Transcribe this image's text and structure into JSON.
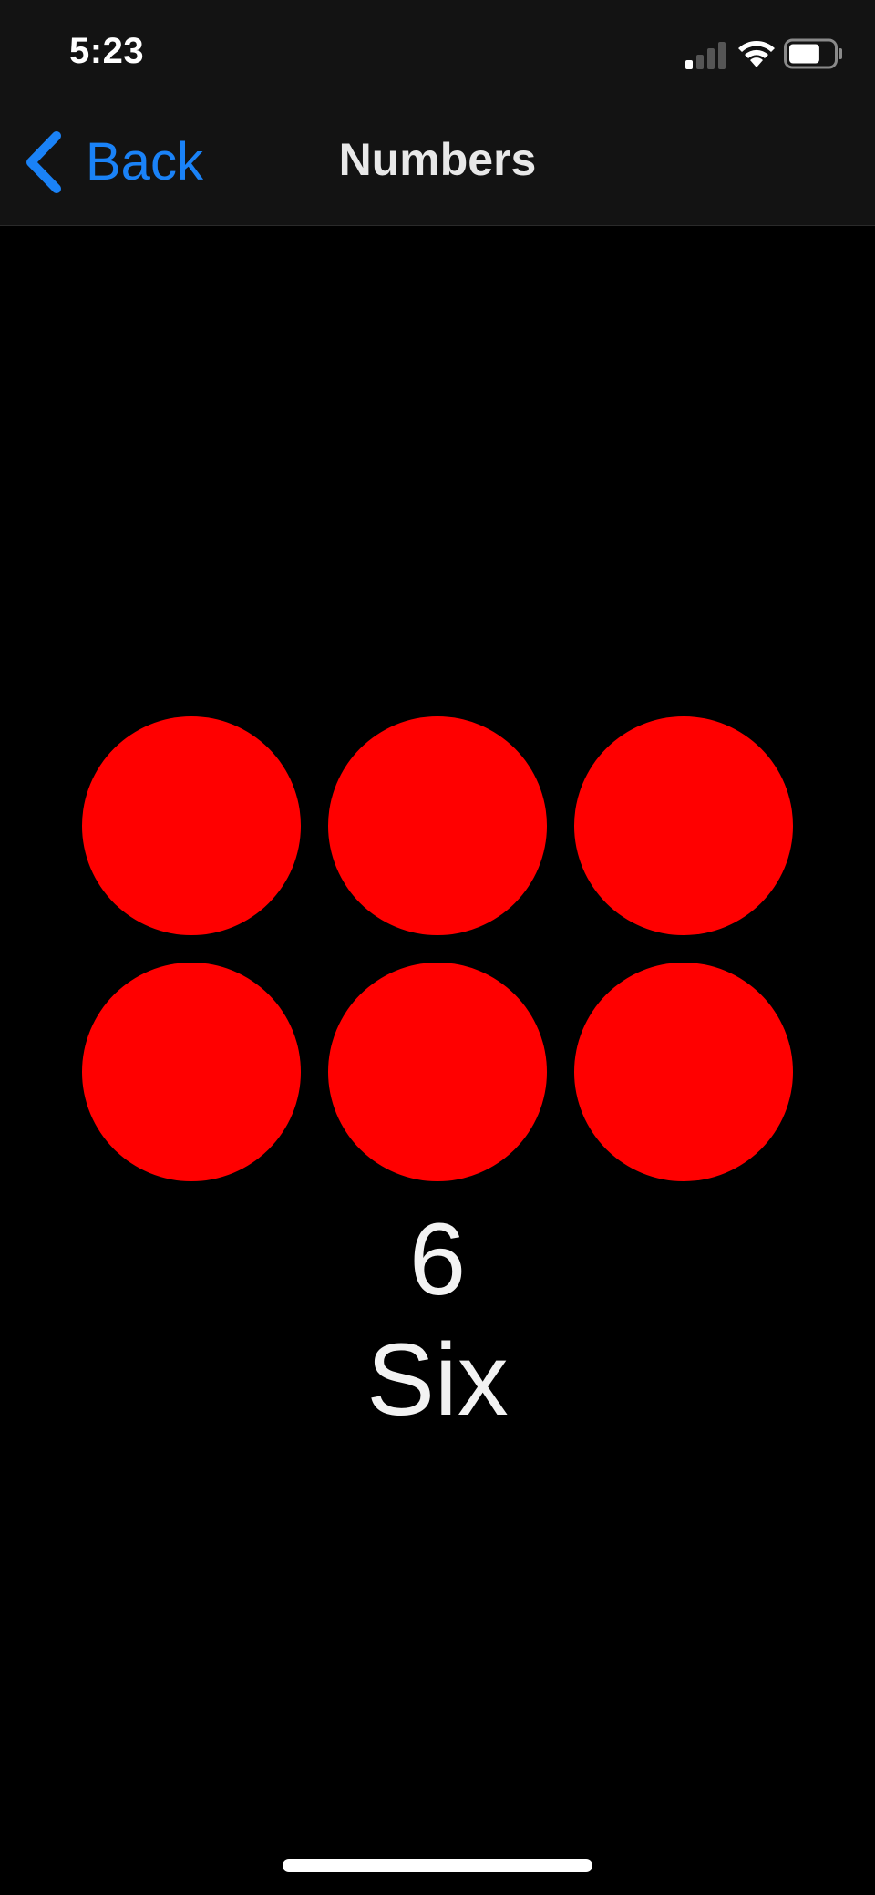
{
  "status_bar": {
    "time": "5:23",
    "icons": [
      "signal-icon",
      "wifi-icon",
      "battery-icon"
    ],
    "battery_level": 0.7
  },
  "nav": {
    "back_label": "Back",
    "title": "Numbers",
    "accent_color": "#1a82f7"
  },
  "content": {
    "count": 6,
    "dot_color": "#ff0000",
    "number_digit": "6",
    "number_word": "Six"
  }
}
